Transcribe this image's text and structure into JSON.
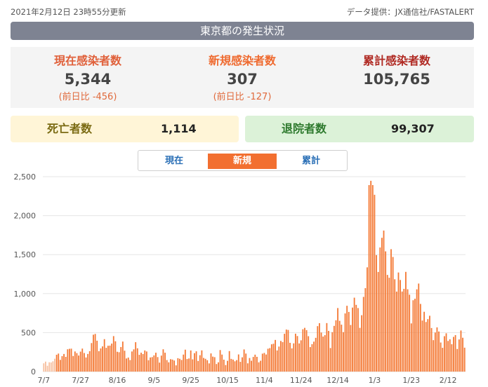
{
  "header": {
    "updated": "2021年2月12日 23時55分更新",
    "source": "データ提供：JX通信社/FASTALERT"
  },
  "banner": {
    "title": "東京都の発生状況"
  },
  "stats": {
    "current": {
      "label": "現在感染者数",
      "value": "5,344",
      "diff": "(前日比 -456)"
    },
    "new": {
      "label": "新規感染者数",
      "value": "307",
      "diff": "(前日比 -127)"
    },
    "total": {
      "label": "累計感染者数",
      "value": "105,765"
    }
  },
  "outcomes": {
    "deaths": {
      "label": "死亡者数",
      "value": "1,114"
    },
    "discharged": {
      "label": "退院者数",
      "value": "99,307"
    }
  },
  "tabs": [
    {
      "label": "現在",
      "active": false
    },
    {
      "label": "新規",
      "active": true
    },
    {
      "label": "累計",
      "active": false
    }
  ],
  "colors": {
    "bar": "#f47a36",
    "bar_faded": "#f7c0a0",
    "grid": "#e6e6e6",
    "banner": "#7e8392"
  },
  "chart_data": {
    "type": "bar",
    "title": "",
    "xlabel": "",
    "ylabel": "",
    "ylim": [
      0,
      2500
    ],
    "yticks": [
      "0",
      "500",
      "1,000",
      "1,500",
      "2,000",
      "2,500"
    ],
    "ytick_values": [
      0,
      500,
      1000,
      1500,
      2000,
      2500
    ],
    "xtick_labels": [
      "7/7",
      "7/27",
      "8/16",
      "9/5",
      "9/25",
      "10/15",
      "11/4",
      "11/24",
      "12/14",
      "1/3",
      "1/23",
      "2/12"
    ],
    "xtick_index": [
      0,
      20,
      40,
      60,
      80,
      100,
      120,
      140,
      160,
      180,
      200,
      220
    ],
    "faded_until": 7,
    "values": [
      106,
      128,
      75,
      119,
      117,
      132,
      165,
      216,
      231,
      150,
      198,
      226,
      189,
      286,
      292,
      294,
      200,
      258,
      237,
      206,
      256,
      295,
      238,
      181,
      226,
      262,
      366,
      473,
      483,
      396,
      262,
      297,
      323,
      416,
      305,
      331,
      333,
      359,
      455,
      389,
      254,
      248,
      315,
      385,
      268,
      168,
      180,
      148,
      258,
      285,
      377,
      299,
      215,
      242,
      225,
      271,
      258,
      146,
      181,
      186,
      208,
      242,
      186,
      115,
      205,
      286,
      242,
      148,
      119,
      159,
      154,
      142,
      80,
      172,
      164,
      149,
      218,
      281,
      161,
      168,
      271,
      157,
      236,
      260,
      136,
      210,
      272,
      175,
      164,
      146,
      105,
      233,
      192,
      185,
      97,
      119,
      276,
      218,
      153,
      84,
      138,
      263,
      163,
      154,
      132,
      147,
      220,
      125,
      183,
      284,
      231,
      106,
      174,
      139,
      188,
      217,
      189,
      119,
      139,
      230,
      239,
      219,
      293,
      301,
      350,
      357,
      406,
      271,
      321,
      393,
      378,
      485,
      539,
      534,
      369,
      298,
      362,
      486,
      456,
      361,
      401,
      543,
      561,
      532,
      454,
      314,
      352,
      384,
      433,
      583,
      621,
      501,
      449,
      467,
      622,
      522,
      302,
      506,
      586,
      658,
      815,
      651,
      602,
      506,
      746,
      844,
      765,
      598,
      821,
      948,
      856,
      815,
      561,
      723,
      958,
      1070,
      1337,
      2392,
      2447,
      2392,
      2268,
      1494,
      1278,
      1592,
      1716,
      1809,
      1542,
      1240,
      1204,
      1570,
      1470,
      1184,
      1026,
      1271,
      1175,
      1027,
      1061,
      1279,
      1056,
      986,
      618,
      915,
      934,
      1055,
      1129,
      868,
      655,
      767,
      636,
      673,
      716,
      559,
      403,
      501,
      567,
      514,
      373,
      305,
      454,
      491,
      393,
      414,
      351,
      445,
      468,
      290,
      412,
      527,
      434,
      307
    ]
  }
}
